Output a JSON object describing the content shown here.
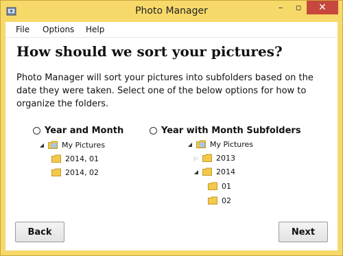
{
  "window": {
    "title": "Photo Manager"
  },
  "titlebar_buttons": {
    "minimize": "–",
    "maximize": "▫",
    "close": "✕"
  },
  "menu": [
    "File",
    "Options",
    "Help"
  ],
  "heading": "How should we sort your pictures?",
  "description": "Photo Manager will sort your pictures into subfolders based on the date they were taken.  Select one of the below options for how to organize the folders.",
  "options": [
    {
      "label": "Year and Month",
      "selected": false,
      "tree": [
        {
          "label": "My Pictures",
          "expander": "expanded",
          "icon": "pictures-folder-icon"
        },
        {
          "label": "2014, 01",
          "expander": "none",
          "icon": "folder-icon"
        },
        {
          "label": "2014, 02",
          "expander": "none",
          "icon": "folder-icon"
        }
      ]
    },
    {
      "label": "Year with Month Subfolders",
      "selected": false,
      "tree": [
        {
          "label": "My Pictures",
          "expander": "expanded",
          "icon": "pictures-folder-icon"
        },
        {
          "label": "2013",
          "expander": "collapsed",
          "icon": "folder-icon"
        },
        {
          "label": "2014",
          "expander": "expanded",
          "icon": "folder-icon"
        },
        {
          "label": "01",
          "expander": "none",
          "icon": "folder-icon"
        },
        {
          "label": "02",
          "expander": "none",
          "icon": "folder-icon"
        }
      ]
    }
  ],
  "buttons": {
    "back": "Back",
    "next": "Next"
  },
  "colors": {
    "title_bar": "#f7d96a",
    "close_button": "#c7483c",
    "folder_fill": "#f2c94c",
    "folder_edge": "#c89a22"
  }
}
